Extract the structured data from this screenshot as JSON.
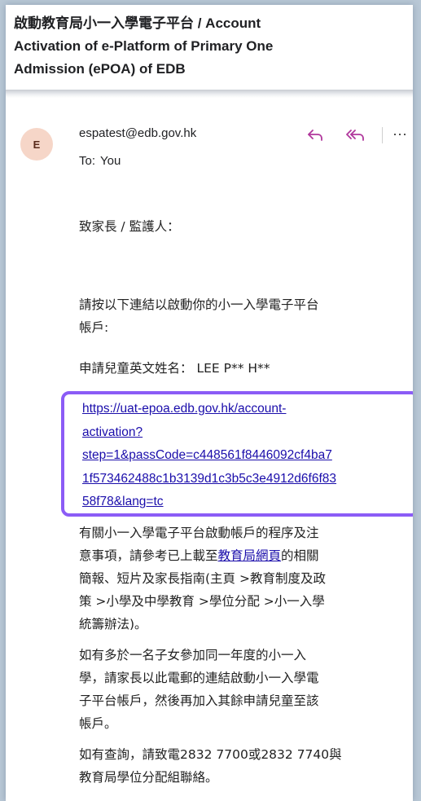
{
  "subject": {
    "lines": [
      "啟動教育局小一入學電子平台 /     Account",
      "Activation of e-Platform of Primary One",
      "Admission (ePOA) of EDB"
    ]
  },
  "header": {
    "avatar_letter": "E",
    "sender": "espatest@edb.gov.hk",
    "to_label": "To:",
    "to_value": "You",
    "more_label": "···"
  },
  "body": {
    "greeting": "致家長 / 監護人：",
    "instruction": [
      "請按以下連結以啟動你的小一入學電子平台",
      "帳戶:"
    ],
    "child_name_label": "申請兒童英文姓名：",
    "child_name_value": "LEE P** H**",
    "activation_link_lines": [
      "https://uat-epoa.edb.gov.hk/account-",
      "activation?",
      "step=1&passCode=c448561f8446092cf4ba7",
      "1f573462488c1b3139d1c3b5c3e4912d6f6f83",
      "58f78&lang=tc"
    ],
    "para2": {
      "line1": "有關小一入學電子平台啟動帳戶的程序及注",
      "line2_pre": "意事項，請參考已上載至",
      "line2_link": "教育局網頁",
      "line2_post": "的相關",
      "line3": "簡報、短片及家長指南(主頁 >教育制度及政",
      "line4": "策 >小學及中學教育 >學位分配 >小一入學",
      "line5": "統籌辦法)。"
    },
    "para3": [
      "如有多於一名子女參加同一年度的小一入",
      "學，請家長以此電郵的連結啟動小一入學電",
      "子平台帳戶，然後再加入其餘申請兒童至該",
      "帳戶。"
    ],
    "para4": [
      "如有查詢，請致電2832 7700或2832 7740與",
      "教育局學位分配組聯絡。"
    ]
  }
}
